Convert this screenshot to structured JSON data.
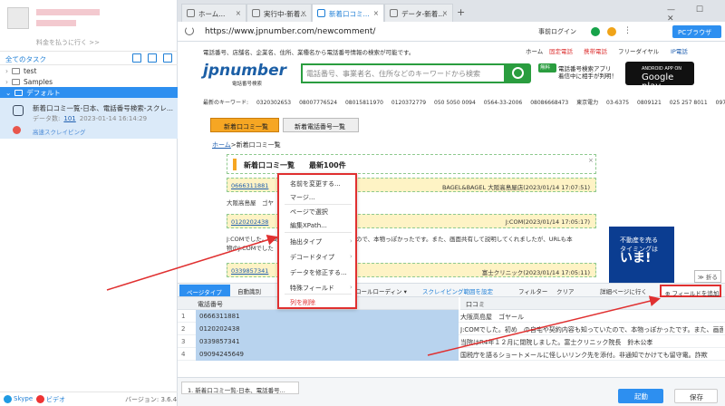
{
  "left": {
    "user_line": "料金を払うに行く >>",
    "tasks_title": "全てのタスク",
    "tree": [
      "test",
      "Samples",
      "デフォルト"
    ],
    "task": {
      "title": "新着口コミ一覧-日本、電話番号検索-スクレ...",
      "data_label": "データ数:",
      "data_count": "101",
      "timestamp": "2023-01-14 16:14:29",
      "mode": "高速スクレイピング"
    },
    "footer": {
      "skype": "Skype",
      "video": "ビデオ",
      "version": "バージョン: 3.6.4"
    }
  },
  "browser": {
    "tabs": [
      "ホーム...",
      "実行中-新着...",
      "新着口コミ...",
      "データ-新着..."
    ],
    "active_tab": 2,
    "new_tab": "+",
    "url": "https://www.jpnumber.com/newcomment/",
    "login": "事前ログイン",
    "pc_browser": "PCブラウザ",
    "window_buttons": "— ☐ ✕"
  },
  "site": {
    "desc": "電話番号、店舗名、企業名、住所、業種名から電話番号情報の検索が可能です。",
    "topnav": [
      "ホーム",
      "固定電話",
      "携帯電話",
      "フリーダイヤル",
      "IP電話"
    ],
    "logo": "jpnumber",
    "logo_sub": "電話番号検索",
    "search_placeholder": "電話番号、事業者名、住所などのキーワードから検索",
    "app_badge": "無料",
    "app_text_1": "電話番号検索アプリ",
    "app_text_2": "着信中に相手が判明！",
    "gplay_small": "ANDROID APP ON",
    "gplay": "Google play",
    "gplay_sub": "今すぐ手に入れよう",
    "keywords_label": "最新のキーワード:",
    "keywords": [
      "0320302653",
      "08007776524",
      "08015811970",
      "0120372779",
      "050 5050 0094",
      "0564-33-2006",
      "08086668473",
      "東京電力",
      "03-6375",
      "0809121",
      "025 257 8011",
      "09757494"
    ],
    "tab_reviews": "新着口コミ一覧",
    "tab_numbers": "新着電話番号一覧",
    "crumb_home": "ホーム",
    "crumb_rest": ">新着口コミ一覧",
    "newbox": "新着口コミ一覧　　最新100件",
    "entry1_id": "0666311881",
    "entry1_right": "BAGEL&BAGEL 大阪高島屋店(2023/01/14 17:07:51)",
    "line1": "大阪高島屋　ゴヤ",
    "entry2_id": "0120202438",
    "entry2_right": "J:COM(2023/01/14 17:05:17)",
    "line2": "J:COMでした。初めて　　　　　　　　　　　たので、本物っぽかったです。また、画面共有して説明してくれましたが、URLも本",
    "line3": "物のJ:COMでした",
    "entry3_id": "0339857341",
    "entry3_right": "富士クリニック(2023/01/14 17:05:11)",
    "ad_text_1": "不動産を売る",
    "ad_text_2": "タイミングは",
    "ad_text_3": "いま!",
    "collapse": "≫ 折る"
  },
  "context_menu": {
    "items": [
      "名前を変更する...",
      "マージ...",
      "ページで選択",
      "編集XPath...",
      "抽出タイプ",
      "デコードタイプ",
      "データを修正する...",
      "特殊フィールド",
      "列を削除"
    ]
  },
  "toolbar": {
    "page_type": "ページタイプ",
    "auto": "自動識別",
    "scroll": "ロールローディン ▾",
    "range": "スクレイピング範囲を設定",
    "filter": "フィルター",
    "clear": "クリア",
    "detail": "詳細ページに行く",
    "add_field": "フィールドを追加"
  },
  "grid": {
    "columns": [
      "電話番号",
      "口コミ"
    ],
    "rows": [
      {
        "no": "1",
        "phone": "0666311881",
        "comment": "大阪高島屋　ゴヤール"
      },
      {
        "no": "2",
        "phone": "0120202438",
        "comment": "J:COMでした。初め　の自宅や契約内容も知っていたので、本物っぽかったです。また、画面共有"
      },
      {
        "no": "3",
        "phone": "0339857341",
        "comment": "当院はR4年１２月に閉院しました。富士クリニック院長　鈴木公孝"
      },
      {
        "no": "4",
        "phone": "09094245649",
        "comment": "国税庁を語るショートメールに怪しいリンク先を添付。非通知でかけても留守電。詐欺"
      }
    ]
  },
  "status": {
    "page_tab": "1. 新着口コミ一覧-日本、電話番号...",
    "start": "起動",
    "save": "保存"
  },
  "colors": {
    "accent": "#2d8ff0",
    "highlight_red": "#e03030",
    "site_green": "#2a9d3f"
  }
}
